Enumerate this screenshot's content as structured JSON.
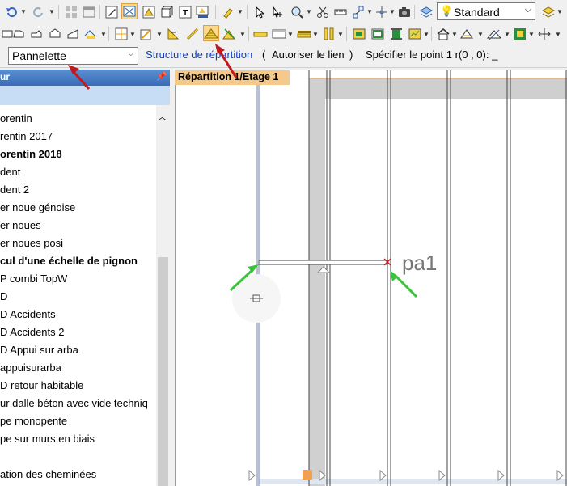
{
  "toolbar": {
    "layer_combo": {
      "value": "Standard"
    }
  },
  "command_bar": {
    "element_type": "Pannelette",
    "command_name": "Structure de répartition",
    "open_paren": "(",
    "option_authorize_link": "Autoriser le lien",
    "close_paren": ")",
    "prompt": "Spécifier le point 1 r(0 , 0): _"
  },
  "side_panel": {
    "header": "ur",
    "items": [
      {
        "label": "orentin",
        "bold": false
      },
      {
        "label": "rentin 2017",
        "bold": false
      },
      {
        "label": "orentin 2018",
        "bold": true
      },
      {
        "label": "dent",
        "bold": false
      },
      {
        "label": "dent 2",
        "bold": false
      },
      {
        "label": "er noue génoise",
        "bold": false
      },
      {
        "label": "er noues",
        "bold": false
      },
      {
        "label": "er noues posi",
        "bold": false
      },
      {
        "label": "cul d'une échelle de pignon",
        "bold": true
      },
      {
        "label": "P combi TopW",
        "bold": false
      },
      {
        "label": "D",
        "bold": false
      },
      {
        "label": "D Accidents",
        "bold": false
      },
      {
        "label": "D Accidents 2",
        "bold": false
      },
      {
        "label": "D Appui sur arba",
        "bold": false
      },
      {
        "label": " appuisurarba",
        "bold": false
      },
      {
        "label": "D retour habitable",
        "bold": false
      },
      {
        "label": "ur dalle béton avec vide techniq",
        "bold": false
      },
      {
        "label": "pe monopente",
        "bold": false
      },
      {
        "label": "pe sur murs en biais",
        "bold": false
      },
      {
        "label": "",
        "bold": false
      },
      {
        "label": "ation des cheminées",
        "bold": false
      }
    ]
  },
  "canvas": {
    "tab_label": "Répartition 1/Etage 1",
    "point_label": "pa1"
  },
  "colors": {
    "annotation_arrow_red": "#c0191f",
    "annotation_arrow_green": "#39c43b",
    "tab_bg": "#f5c98a",
    "selection_line_orange": "#f0a050"
  }
}
